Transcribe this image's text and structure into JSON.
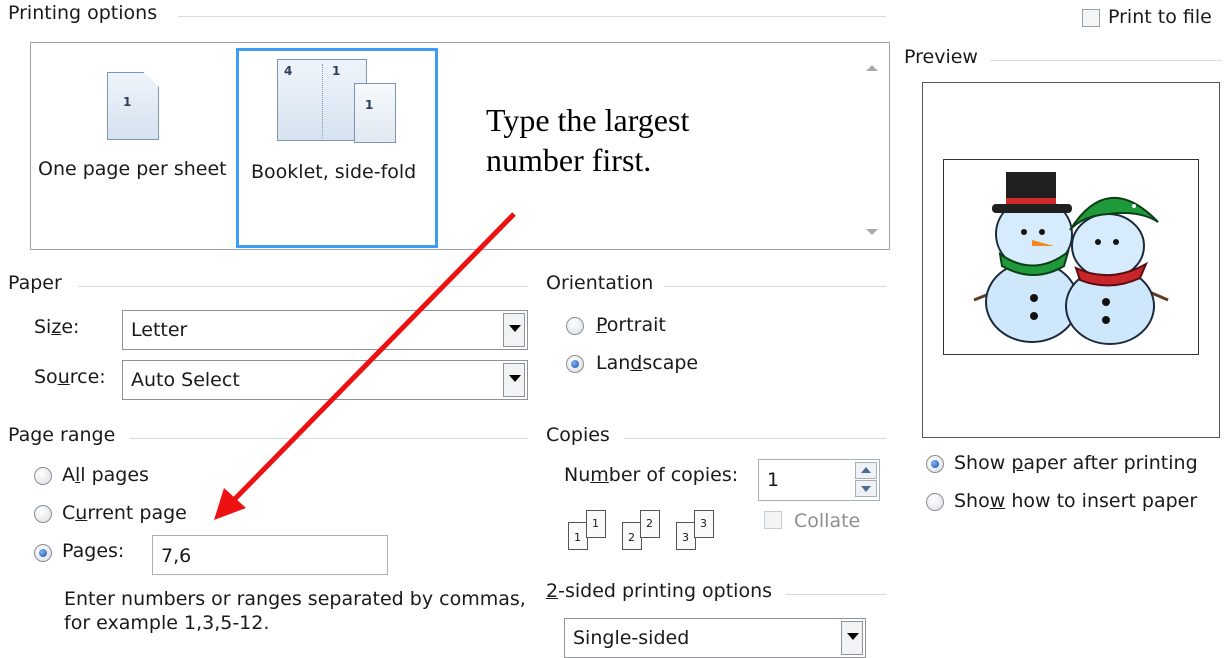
{
  "printing_options": {
    "title": "Printing options",
    "options": [
      {
        "label": "One page per sheet",
        "selected": false
      },
      {
        "label": "Booklet, side-fold",
        "selected": true
      }
    ],
    "print_to_file": {
      "label": "Print to file",
      "checked": false
    }
  },
  "annotation": {
    "line1": "Type the largest",
    "line2": "number first."
  },
  "paper": {
    "title": "Paper",
    "size_label": "Size:",
    "size_value": "Letter",
    "source_label": "Source:",
    "source_value": "Auto Select"
  },
  "orientation": {
    "title": "Orientation",
    "portrait": "Portrait",
    "landscape": "Landscape",
    "selected": "Landscape"
  },
  "page_range": {
    "title": "Page range",
    "all": "All pages",
    "current": "Current page",
    "pages": "Pages:",
    "pages_value": "7,6",
    "hint_line1": "Enter numbers or ranges separated by commas,",
    "hint_line2": "for example 1,3,5-12.",
    "selected": "Pages"
  },
  "copies": {
    "title": "Copies",
    "number_label": "Number of copies:",
    "number_value": "1",
    "collate_label": "Collate",
    "collate_enabled": false,
    "collate_icons": [
      "1",
      "2",
      "3"
    ]
  },
  "two_sided": {
    "title": "2-sided printing options",
    "value": "Single-sided"
  },
  "preview": {
    "title": "Preview",
    "show_after": "Show paper after printing",
    "show_insert": "Show how to insert paper",
    "selected": "show_after"
  },
  "colors": {
    "arrow": "#ee1111",
    "selection_border": "#3d9df3"
  },
  "icons": {
    "arrow_icon": "red-arrow",
    "preview_image": "snowmen-clipart"
  }
}
